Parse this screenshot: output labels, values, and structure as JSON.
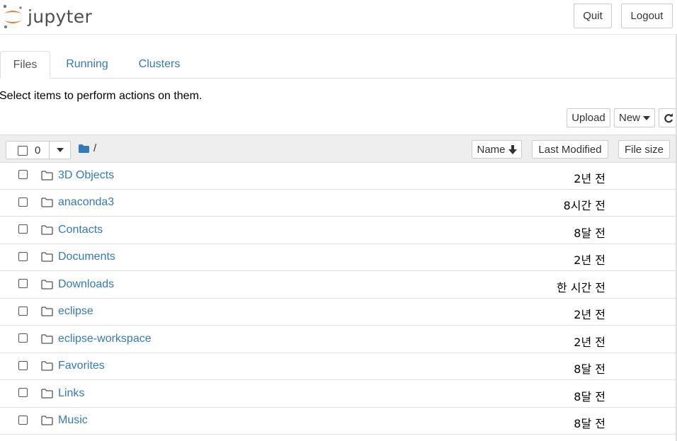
{
  "header": {
    "logo_text": "jupyter",
    "quit_label": "Quit",
    "logout_label": "Logout"
  },
  "tabs": [
    {
      "label": "Files"
    },
    {
      "label": "Running"
    },
    {
      "label": "Clusters"
    }
  ],
  "instructions": "Select items to perform actions on them.",
  "toolbar": {
    "upload_label": "Upload",
    "new_label": "New"
  },
  "list_header": {
    "selected_count": "0",
    "breadcrumb": "/",
    "sort_name_label": "Name",
    "sort_modified_label": "Last Modified",
    "sort_size_label": "File size"
  },
  "items": [
    {
      "name": "3D Objects",
      "modified": "2년 전"
    },
    {
      "name": "anaconda3",
      "modified": "8시간 전"
    },
    {
      "name": "Contacts",
      "modified": "8달 전"
    },
    {
      "name": "Documents",
      "modified": "2년 전"
    },
    {
      "name": "Downloads",
      "modified": "한 시간 전"
    },
    {
      "name": "eclipse",
      "modified": "2년 전"
    },
    {
      "name": "eclipse-workspace",
      "modified": "2년 전"
    },
    {
      "name": "Favorites",
      "modified": "8달 전"
    },
    {
      "name": "Links",
      "modified": "8달 전"
    },
    {
      "name": "Music",
      "modified": "8달 전"
    }
  ],
  "colors": {
    "link": "#337ab7",
    "folder_header_icon": "#337ab7",
    "logo_orange": "#f37726",
    "logo_gray": "#767677"
  },
  "icons": {
    "logo": "jupyter-logo-icon",
    "new_caret": "caret-down-icon",
    "refresh": "refresh-icon",
    "dropdown": "caret-down-icon",
    "breadcrumb_folder": "folder-solid-icon",
    "sort": "arrow-down-icon",
    "item_folder": "folder-outline-icon"
  }
}
